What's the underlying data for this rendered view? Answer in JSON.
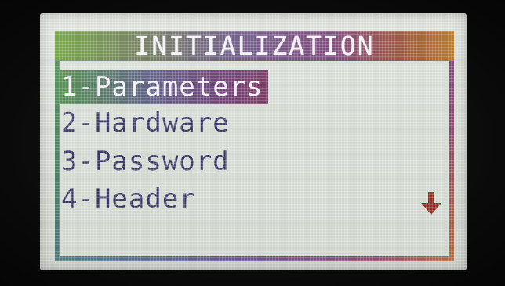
{
  "screen": {
    "title": "INITIALIZATION",
    "menu": [
      {
        "label": "1-Parameters",
        "selected": true
      },
      {
        "label": "2-Hardware",
        "selected": false
      },
      {
        "label": "3-Password",
        "selected": false
      },
      {
        "label": "4-Header",
        "selected": false
      }
    ],
    "scroll_indicator": "arrow-down-icon"
  },
  "colors": {
    "lcd_background": "#d8ddd6",
    "text": "#3c3866",
    "highlight_start": "#4d8a4a",
    "highlight_end": "#7a3c62",
    "arrow": "#8a2f24"
  }
}
